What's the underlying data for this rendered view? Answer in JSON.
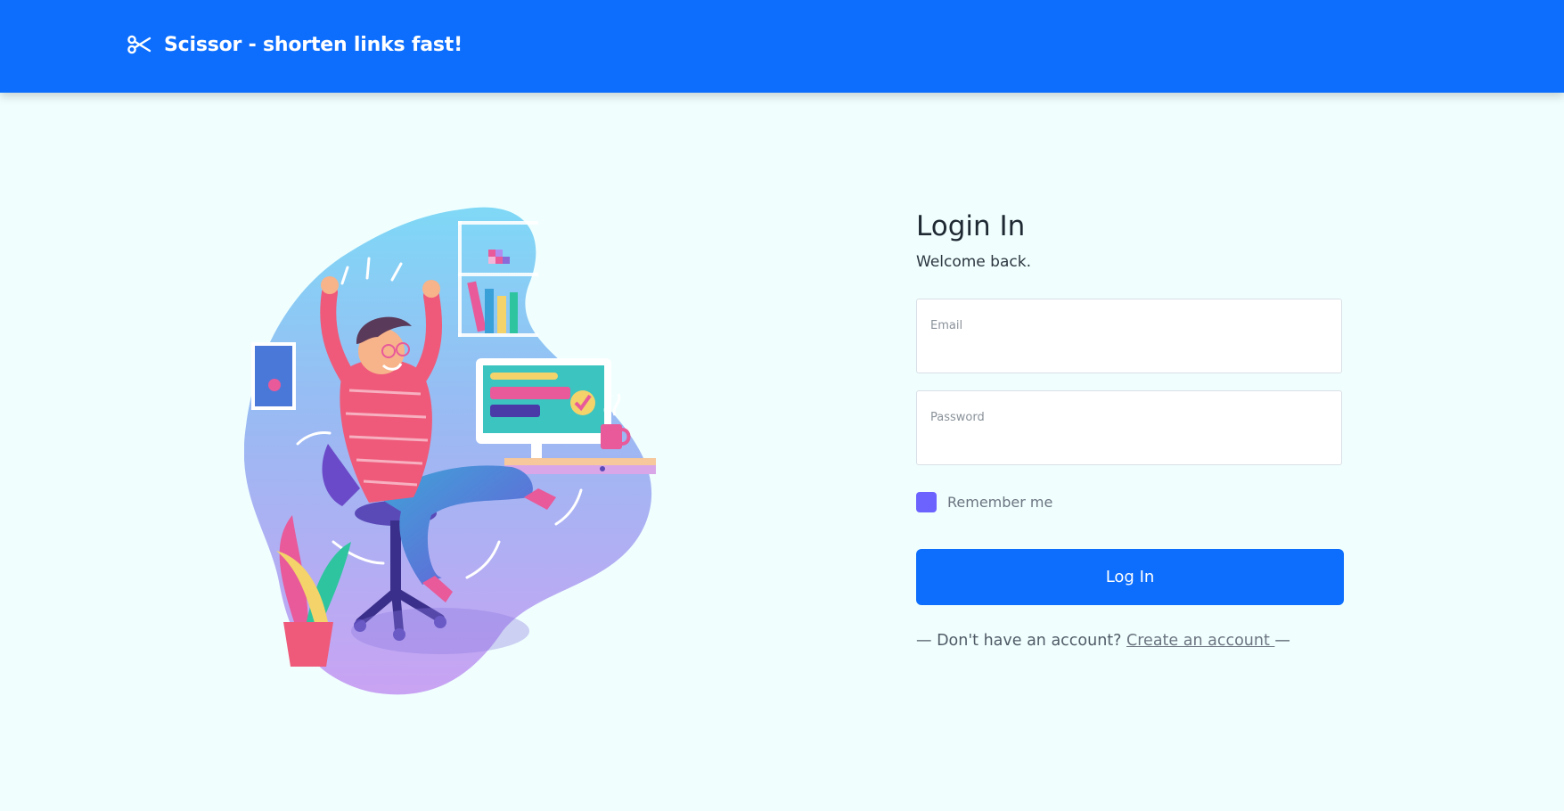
{
  "navbar": {
    "brand_icon": "scissors-icon",
    "brand_text": "Scissor - shorten links fast!",
    "background_color": "#0d6efd"
  },
  "illustration": {
    "icon": "celebrating-person-at-desk-illustration"
  },
  "login": {
    "title": "Login In",
    "subtitle": "Welcome back.",
    "email": {
      "label": "Email",
      "value": ""
    },
    "password": {
      "label": "Password",
      "value": ""
    },
    "remember_label": "Remember me",
    "remember_checked": true,
    "submit_label": "Log In",
    "signup_prefix": "— Don't have an account? ",
    "signup_link": "Create an account ",
    "signup_suffix": "—",
    "accent_color": "#0d6efd",
    "checkbox_color": "#6c63ff"
  }
}
